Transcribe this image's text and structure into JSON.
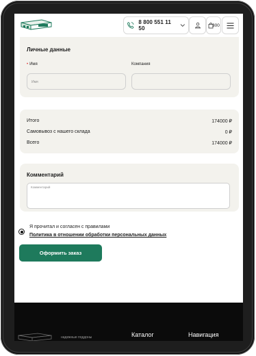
{
  "header": {
    "phone": "8 800 551 11 50",
    "cart_count": "300",
    "brand_color": "#1e7a5c"
  },
  "personal": {
    "title": "Личные данные",
    "name_label": "Имя",
    "name_required_mark": "•",
    "name_placeholder": "Имя",
    "company_label": "Компания",
    "company_placeholder": ""
  },
  "totals": [
    {
      "label": "Итого",
      "value": "174000 ₽"
    },
    {
      "label": "Самовывоз с нашего склада",
      "value": "0 ₽"
    },
    {
      "label": "Всего",
      "value": "174000 ₽"
    }
  ],
  "comment": {
    "title": "Комментарий",
    "placeholder": "Комментарий"
  },
  "agreement": {
    "text": "Я прочитал и согласен с правилами",
    "policy_link": "Политика в отношении обработки персональных данных",
    "checked": true
  },
  "submit_label": "Оформить заказ",
  "footer": {
    "tagline": "надежные поддоны",
    "catalog": "Каталог",
    "navigation": "Навигация"
  }
}
